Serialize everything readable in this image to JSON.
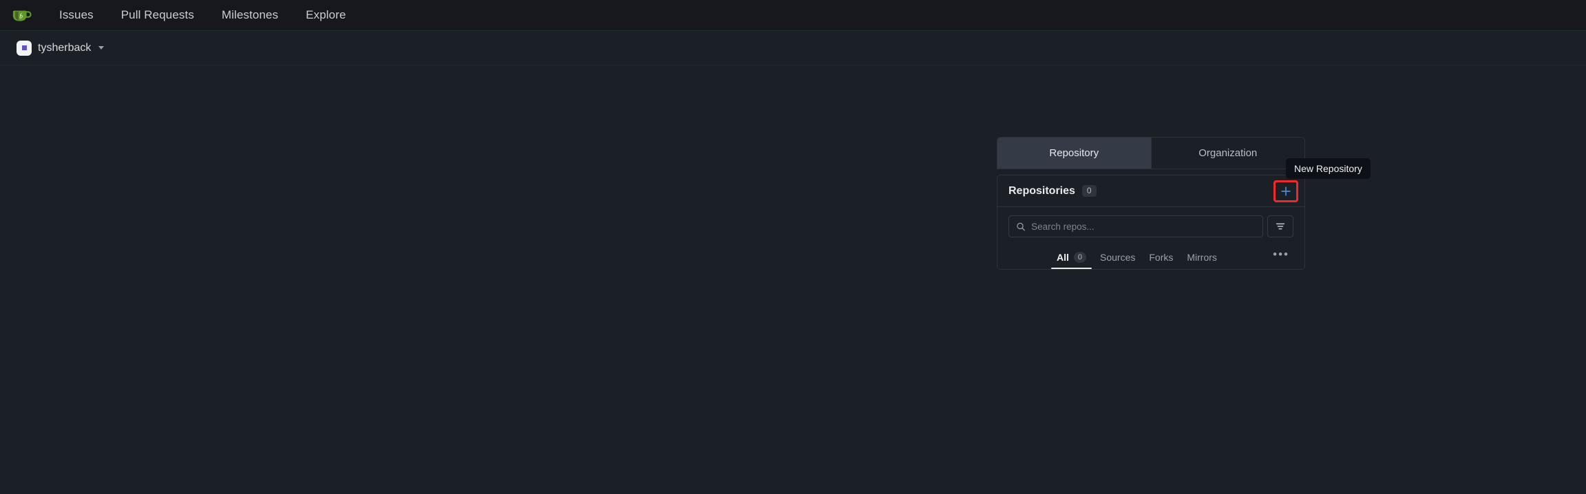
{
  "navbar": {
    "logo_icon": "gitea-teacup-logo",
    "links": [
      {
        "label": "Issues",
        "name": "nav-link-issues"
      },
      {
        "label": "Pull Requests",
        "name": "nav-link-pull-requests"
      },
      {
        "label": "Milestones",
        "name": "nav-link-milestones"
      },
      {
        "label": "Explore",
        "name": "nav-link-explore"
      }
    ]
  },
  "context": {
    "username": "tysherback",
    "avatar_icon": "user-avatar",
    "caret_icon": "chevron-down-icon"
  },
  "dashboard": {
    "segment_tabs": [
      {
        "label": "Repository",
        "active": true
      },
      {
        "label": "Organization",
        "active": false
      }
    ],
    "repositories": {
      "title": "Repositories",
      "count": "0",
      "new_button_icon": "plus-icon",
      "new_button_tooltip": "New Repository",
      "search": {
        "placeholder": "Search repos...",
        "value": "",
        "search_icon": "search-icon",
        "filter_icon": "filter-icon"
      },
      "filter_tabs": [
        {
          "label": "All",
          "badge": "0",
          "active": true
        },
        {
          "label": "Sources",
          "badge": "",
          "active": false
        },
        {
          "label": "Forks",
          "badge": "",
          "active": false
        },
        {
          "label": "Mirrors",
          "badge": "",
          "active": false
        }
      ],
      "more_label": "•••"
    }
  },
  "colors": {
    "page_bg": "#1b1f26",
    "navbar_bg": "#16181d",
    "accent_plus": "#4b8dd6",
    "highlight_box": "#ee2b2b",
    "active_tab_bg": "#353b46",
    "avatar_dot": "#5b52c4"
  }
}
